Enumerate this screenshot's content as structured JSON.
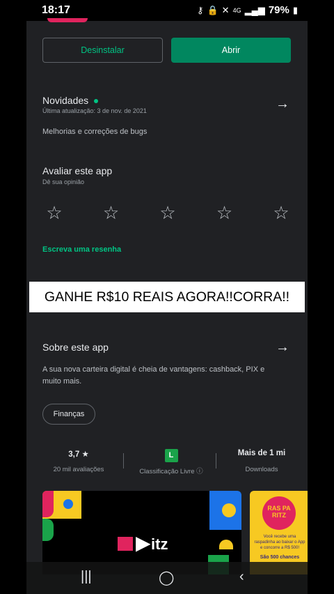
{
  "status_bar": {
    "time": "18:17",
    "signal": "4G",
    "battery": "79%"
  },
  "actions": {
    "uninstall": "Desinstalar",
    "open": "Abrir"
  },
  "whats_new": {
    "title": "Novidades",
    "updated": "Última atualização: 3 de nov. de 2021",
    "body": "Melhorias e correções de bugs"
  },
  "rate": {
    "title": "Avaliar este app",
    "subtitle": "Dê sua opinião",
    "write_review": "Escreva uma resenha"
  },
  "banner": {
    "text": "GANHE R$10 REAIS AGORA!!CORRA!!"
  },
  "about": {
    "title": "Sobre este app",
    "description": "A sua nova carteira digital é cheia de vantagens: cashback, PIX e muito mais.",
    "category_chip": "Finanças"
  },
  "stats": {
    "rating_value": "3,7",
    "rating_label": "20 mil avaliações",
    "content_badge": "L",
    "content_label": "Classificação Livre",
    "downloads_value": "Mais de 1 mi",
    "downloads_label": "Downloads"
  },
  "screenshots": {
    "first_brand": "itz",
    "second_logo": "RAS PA RITZ",
    "second_caption": "Você recebe uma raspadinha ao baixar o App e concorre a R$ 500!",
    "second_chances": "São 500 chances"
  },
  "colors": {
    "accent": "#00c383",
    "open_button": "#01875f",
    "background": "#202124"
  }
}
